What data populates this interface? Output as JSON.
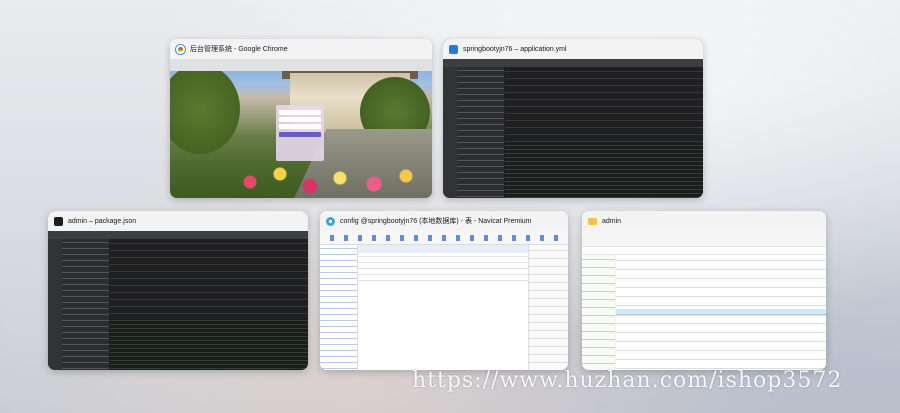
{
  "windows": {
    "chrome": {
      "title": "后台管理系统 - Google Chrome",
      "icon": "chrome-icon"
    },
    "idea_app": {
      "title": "springbootyjn76 – application.yml",
      "icon": "intellij-icon"
    },
    "idea_pkg": {
      "title": "admin – package.json",
      "icon": "webstorm-icon"
    },
    "navicat": {
      "title": "config @springbootyjn76 (本地数据库) - 表 - Navicat Premium",
      "icon": "navicat-icon"
    },
    "explorer": {
      "title": "admin",
      "icon": "folder-icon"
    }
  },
  "watermark": "https://www.huzhan.com/ishop3572",
  "colors": {
    "accent": "#0078d7",
    "ide_bg": "#2b2d30",
    "folder": "#f5c14c"
  }
}
